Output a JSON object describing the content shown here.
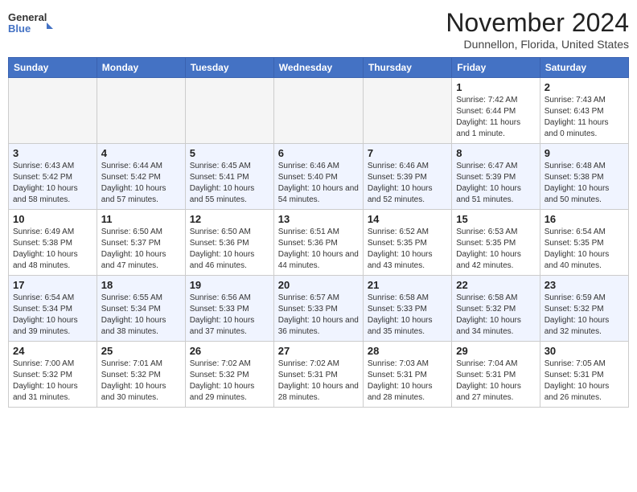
{
  "header": {
    "logo_line1": "General",
    "logo_line2": "Blue",
    "month": "November 2024",
    "location": "Dunnellon, Florida, United States"
  },
  "weekdays": [
    "Sunday",
    "Monday",
    "Tuesday",
    "Wednesday",
    "Thursday",
    "Friday",
    "Saturday"
  ],
  "weeks": [
    [
      {
        "day": "",
        "empty": true
      },
      {
        "day": "",
        "empty": true
      },
      {
        "day": "",
        "empty": true
      },
      {
        "day": "",
        "empty": true
      },
      {
        "day": "",
        "empty": true
      },
      {
        "day": "1",
        "sunrise": "7:42 AM",
        "sunset": "6:44 PM",
        "daylight": "11 hours and 1 minute."
      },
      {
        "day": "2",
        "sunrise": "7:43 AM",
        "sunset": "6:43 PM",
        "daylight": "11 hours and 0 minutes."
      }
    ],
    [
      {
        "day": "3",
        "sunrise": "6:43 AM",
        "sunset": "5:42 PM",
        "daylight": "10 hours and 58 minutes."
      },
      {
        "day": "4",
        "sunrise": "6:44 AM",
        "sunset": "5:42 PM",
        "daylight": "10 hours and 57 minutes."
      },
      {
        "day": "5",
        "sunrise": "6:45 AM",
        "sunset": "5:41 PM",
        "daylight": "10 hours and 55 minutes."
      },
      {
        "day": "6",
        "sunrise": "6:46 AM",
        "sunset": "5:40 PM",
        "daylight": "10 hours and 54 minutes."
      },
      {
        "day": "7",
        "sunrise": "6:46 AM",
        "sunset": "5:39 PM",
        "daylight": "10 hours and 52 minutes."
      },
      {
        "day": "8",
        "sunrise": "6:47 AM",
        "sunset": "5:39 PM",
        "daylight": "10 hours and 51 minutes."
      },
      {
        "day": "9",
        "sunrise": "6:48 AM",
        "sunset": "5:38 PM",
        "daylight": "10 hours and 50 minutes."
      }
    ],
    [
      {
        "day": "10",
        "sunrise": "6:49 AM",
        "sunset": "5:38 PM",
        "daylight": "10 hours and 48 minutes."
      },
      {
        "day": "11",
        "sunrise": "6:50 AM",
        "sunset": "5:37 PM",
        "daylight": "10 hours and 47 minutes."
      },
      {
        "day": "12",
        "sunrise": "6:50 AM",
        "sunset": "5:36 PM",
        "daylight": "10 hours and 46 minutes."
      },
      {
        "day": "13",
        "sunrise": "6:51 AM",
        "sunset": "5:36 PM",
        "daylight": "10 hours and 44 minutes."
      },
      {
        "day": "14",
        "sunrise": "6:52 AM",
        "sunset": "5:35 PM",
        "daylight": "10 hours and 43 minutes."
      },
      {
        "day": "15",
        "sunrise": "6:53 AM",
        "sunset": "5:35 PM",
        "daylight": "10 hours and 42 minutes."
      },
      {
        "day": "16",
        "sunrise": "6:54 AM",
        "sunset": "5:35 PM",
        "daylight": "10 hours and 40 minutes."
      }
    ],
    [
      {
        "day": "17",
        "sunrise": "6:54 AM",
        "sunset": "5:34 PM",
        "daylight": "10 hours and 39 minutes."
      },
      {
        "day": "18",
        "sunrise": "6:55 AM",
        "sunset": "5:34 PM",
        "daylight": "10 hours and 38 minutes."
      },
      {
        "day": "19",
        "sunrise": "6:56 AM",
        "sunset": "5:33 PM",
        "daylight": "10 hours and 37 minutes."
      },
      {
        "day": "20",
        "sunrise": "6:57 AM",
        "sunset": "5:33 PM",
        "daylight": "10 hours and 36 minutes."
      },
      {
        "day": "21",
        "sunrise": "6:58 AM",
        "sunset": "5:33 PM",
        "daylight": "10 hours and 35 minutes."
      },
      {
        "day": "22",
        "sunrise": "6:58 AM",
        "sunset": "5:32 PM",
        "daylight": "10 hours and 34 minutes."
      },
      {
        "day": "23",
        "sunrise": "6:59 AM",
        "sunset": "5:32 PM",
        "daylight": "10 hours and 32 minutes."
      }
    ],
    [
      {
        "day": "24",
        "sunrise": "7:00 AM",
        "sunset": "5:32 PM",
        "daylight": "10 hours and 31 minutes."
      },
      {
        "day": "25",
        "sunrise": "7:01 AM",
        "sunset": "5:32 PM",
        "daylight": "10 hours and 30 minutes."
      },
      {
        "day": "26",
        "sunrise": "7:02 AM",
        "sunset": "5:32 PM",
        "daylight": "10 hours and 29 minutes."
      },
      {
        "day": "27",
        "sunrise": "7:02 AM",
        "sunset": "5:31 PM",
        "daylight": "10 hours and 28 minutes."
      },
      {
        "day": "28",
        "sunrise": "7:03 AM",
        "sunset": "5:31 PM",
        "daylight": "10 hours and 28 minutes."
      },
      {
        "day": "29",
        "sunrise": "7:04 AM",
        "sunset": "5:31 PM",
        "daylight": "10 hours and 27 minutes."
      },
      {
        "day": "30",
        "sunrise": "7:05 AM",
        "sunset": "5:31 PM",
        "daylight": "10 hours and 26 minutes."
      }
    ]
  ]
}
